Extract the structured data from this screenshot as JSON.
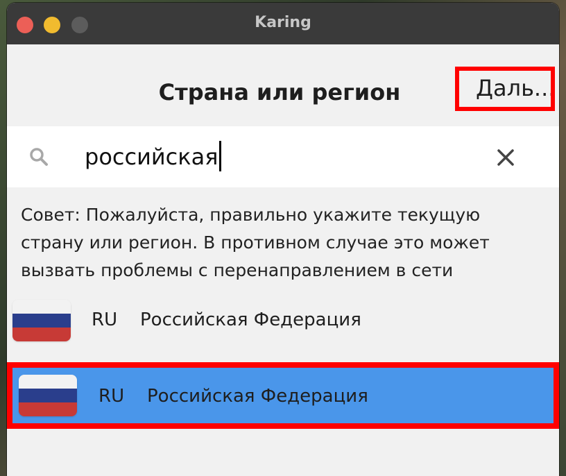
{
  "window": {
    "title": "Karing"
  },
  "header": {
    "title": "Страна или регион",
    "next_label": "Даль..."
  },
  "search": {
    "value": "российская",
    "icon": "search-icon",
    "clear_icon": "close-icon"
  },
  "hint": "Совет: Пожалуйста, правильно укажите текущую страну или регион. В противном случае это может вызвать проблемы с перенаправлением в сети",
  "results": [
    {
      "code": "RU",
      "name": "Российская Федерация",
      "selected": false
    },
    {
      "code": "RU",
      "name": "Российская Федерация",
      "selected": true
    }
  ],
  "colors": {
    "selected_row": "#4a96ea",
    "highlight_frame": "#ff0000",
    "titlebar": "#3a3a3a"
  }
}
